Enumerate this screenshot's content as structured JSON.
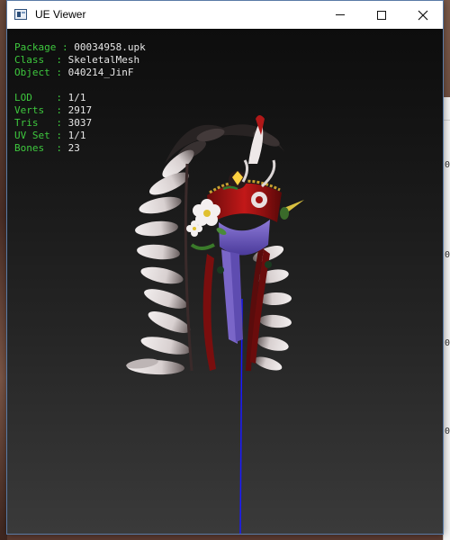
{
  "window": {
    "title": "UE Viewer",
    "controls": {
      "minimize": "minimize",
      "maximize": "maximize",
      "close": "close"
    }
  },
  "info": {
    "group1": [
      {
        "label": "Package",
        "value": "00034958.upk"
      },
      {
        "label": "Class  ",
        "value": "SkeletalMesh"
      },
      {
        "label": "Object ",
        "value": "040214_JinF"
      }
    ],
    "group2": [
      {
        "label": "LOD    ",
        "value": "1/1"
      },
      {
        "label": "Verts  ",
        "value": "2917"
      },
      {
        "label": "Tris   ",
        "value": "3037"
      },
      {
        "label": "UV Set ",
        "value": "1/1"
      },
      {
        "label": "Bones  ",
        "value": "23"
      }
    ]
  },
  "colors": {
    "label": "#3ec83e",
    "value": "#e6e6e6",
    "bone_line": "#1a1aff",
    "feather_dark": "#8a1010"
  }
}
